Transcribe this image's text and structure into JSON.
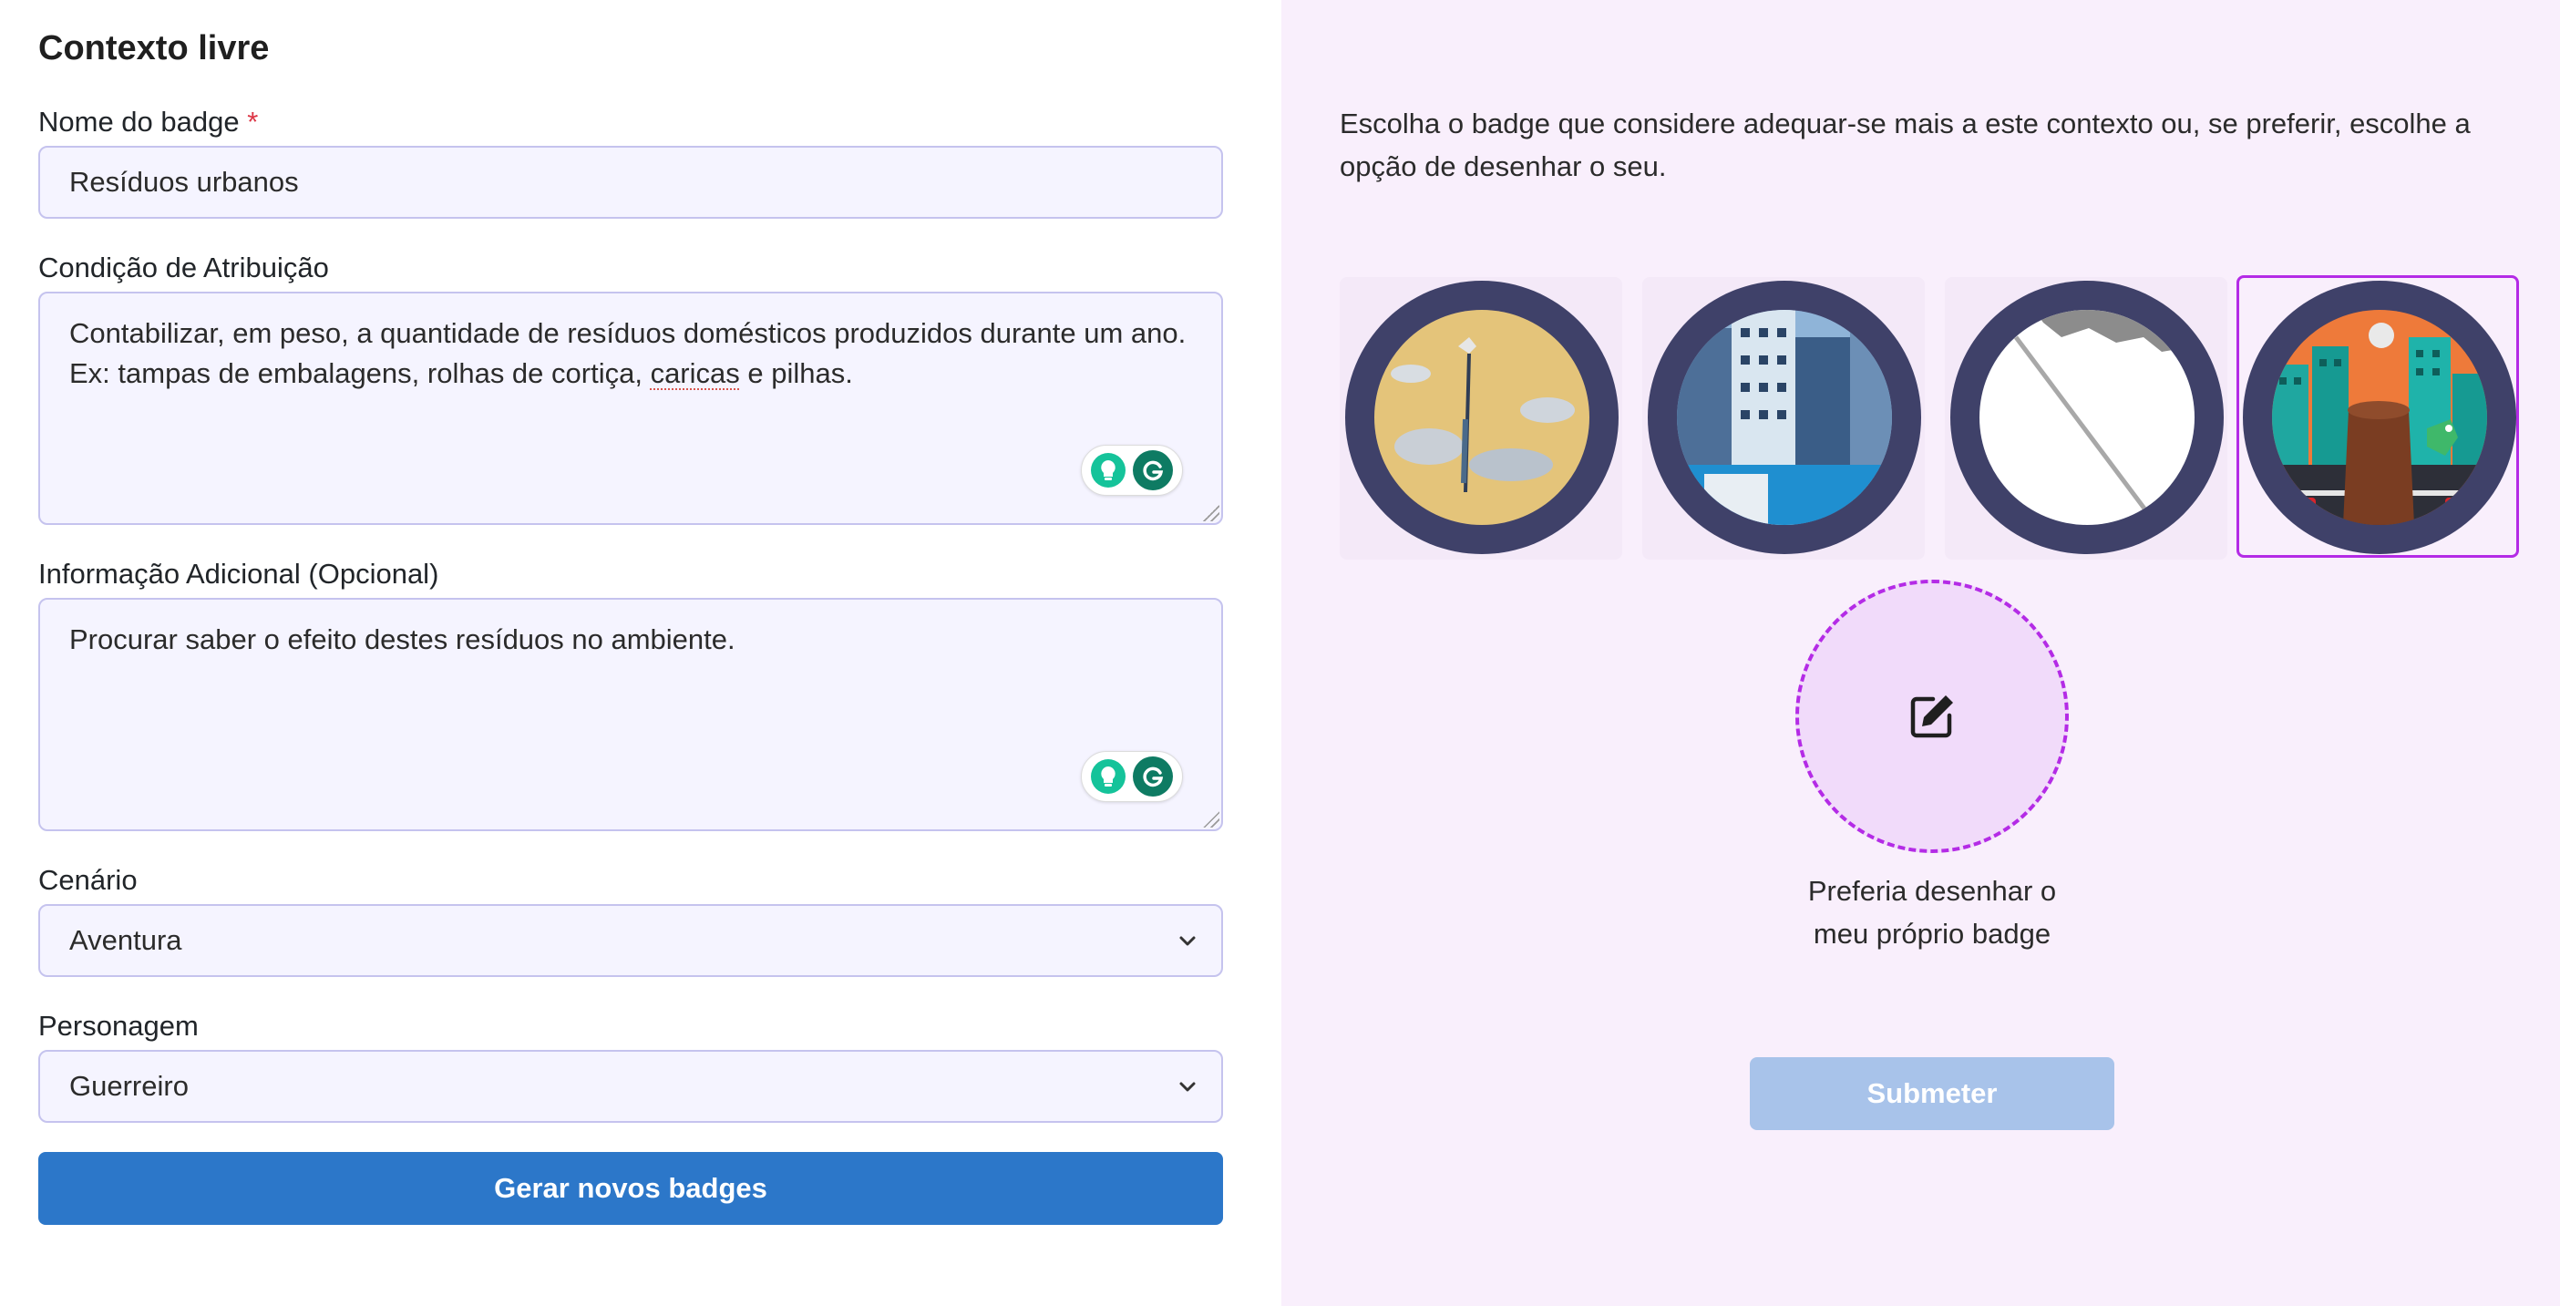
{
  "form": {
    "title": "Contexto livre",
    "name_label": "Nome do badge",
    "required_mark": "*",
    "name_value": "Resíduos urbanos",
    "condition_label": "Condição de Atribuição",
    "condition_text_before": "Contabilizar, em peso, a quantidade de resíduos domésticos produzidos durante um ano. Ex: tampas de embalagens, rolhas de cortiça, ",
    "condition_text_spell": "caricas",
    "condition_text_after": " e pilhas.",
    "additional_label": "Informação Adicional (Opcional)",
    "additional_value": "Procurar saber o efeito destes resíduos no ambiente.",
    "scenario_label": "Cenário",
    "scenario_value": "Aventura",
    "character_label": "Personagem",
    "character_value": "Guerreiro",
    "generate_button": "Gerar novos badges"
  },
  "badges": {
    "instructions": "Escolha o badge que considere adequar-se mais a este contexto ou, se preferir, escolhe a opção de desenhar o seu.",
    "selected_index": 3,
    "draw_own_label": "Preferia desenhar o meu próprio badge",
    "submit_button": "Submeter"
  },
  "colors": {
    "accent_purple": "#b42be6",
    "primary_blue": "#2c77c9",
    "badge_ring": "#3f4169",
    "right_panel_bg": "#f9effc"
  }
}
